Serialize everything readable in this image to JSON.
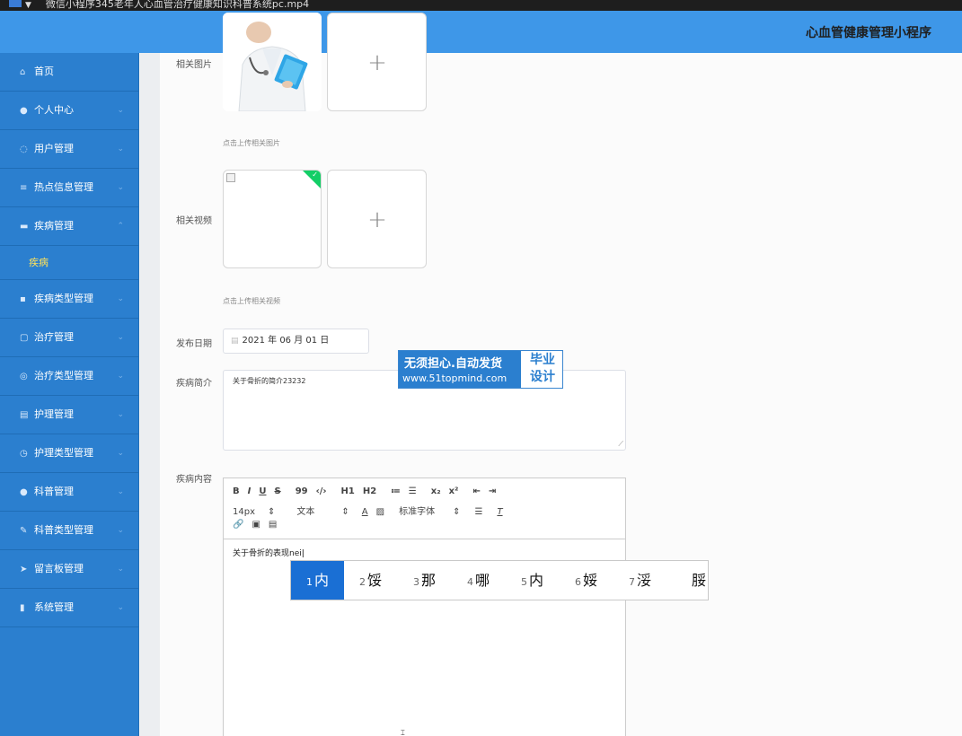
{
  "window": {
    "title": "微信小程序345老年人心血管治疗健康知识科普系统pc.mp4"
  },
  "header": {
    "app_title": "心血管健康管理小程序"
  },
  "sidebar": {
    "items": [
      {
        "label": "首页",
        "icon": "home-icon",
        "has_children": false
      },
      {
        "label": "个人中心",
        "icon": "user-icon",
        "has_children": true
      },
      {
        "label": "用户管理",
        "icon": "users-icon",
        "has_children": true
      },
      {
        "label": "热点信息管理",
        "icon": "list-icon",
        "has_children": true
      },
      {
        "label": "疾病管理",
        "icon": "briefcase-icon",
        "has_children": true,
        "expanded": true,
        "sub_items": [
          {
            "label": "疾病"
          }
        ]
      },
      {
        "label": "疾病类型管理",
        "icon": "card-icon",
        "has_children": true
      },
      {
        "label": "治疗管理",
        "icon": "copy-icon",
        "has_children": true
      },
      {
        "label": "治疗类型管理",
        "icon": "globe-icon",
        "has_children": true
      },
      {
        "label": "护理管理",
        "icon": "doc-icon",
        "has_children": true
      },
      {
        "label": "护理类型管理",
        "icon": "clock-icon",
        "has_children": true
      },
      {
        "label": "科普管理",
        "icon": "drop-icon",
        "has_children": true
      },
      {
        "label": "科普类型管理",
        "icon": "pen-icon",
        "has_children": true
      },
      {
        "label": "留言板管理",
        "icon": "send-icon",
        "has_children": true
      },
      {
        "label": "系统管理",
        "icon": "chart-icon",
        "has_children": true
      }
    ]
  },
  "form": {
    "image_field": {
      "label": "相关图片",
      "hint": "点击上传相关图片"
    },
    "video_field": {
      "label": "相关视频",
      "hint": "点击上传相关视频"
    },
    "date_field": {
      "label": "发布日期",
      "value": "2021 年 06 月 01 日"
    },
    "intro_field": {
      "label": "疾病简介",
      "value": "关于骨折的简介23232"
    },
    "content_field": {
      "label": "疾病内容",
      "value": "关于骨折的表现nei"
    }
  },
  "editor_toolbar": {
    "row1": [
      "B",
      "I",
      "U",
      "S",
      "99",
      "‹/›",
      "H1",
      "H2",
      "≔",
      "☰",
      "x₂",
      "x²",
      "⇤",
      "⇥"
    ],
    "font_size": "14px",
    "text_type": "文本",
    "font_family": "标准字体",
    "row3_icons": [
      "link-icon",
      "image-icon",
      "video-icon"
    ]
  },
  "watermark": {
    "line1": "无须担心.自动发货",
    "line2": "www.51topmind.com",
    "right_line1": "毕业",
    "right_line2": "设计"
  },
  "ime": {
    "candidates": [
      {
        "n": "1",
        "text": "内",
        "selected": true
      },
      {
        "n": "2",
        "text": "馁"
      },
      {
        "n": "3",
        "text": "那"
      },
      {
        "n": "4",
        "text": "哪"
      },
      {
        "n": "5",
        "text": "内"
      },
      {
        "n": "6",
        "text": "娞"
      },
      {
        "n": "7",
        "text": "浽"
      },
      {
        "n": "",
        "text": "脮"
      }
    ]
  },
  "colors": {
    "header": "#3e97e8",
    "sidebar": "#2b7fcf",
    "active_sub": "#ffe25a",
    "ime_selected": "#1a6fd4"
  }
}
